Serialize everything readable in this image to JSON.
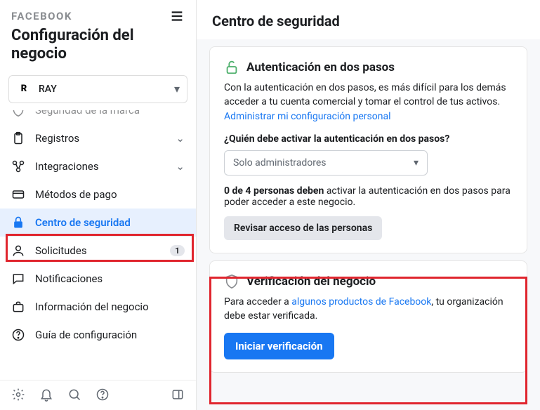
{
  "brand": "FACEBOOK",
  "title": "Configuración del negocio",
  "account": {
    "name": "RAY",
    "logo": "R"
  },
  "nav": {
    "cropped": "Seguridad de la marca",
    "registros": "Registros",
    "integraciones": "Integraciones",
    "pagos": "Métodos de pago",
    "seguridad": "Centro de seguridad",
    "solicitudes": "Solicitudes",
    "solicitudes_badge": "1",
    "notificaciones": "Notificaciones",
    "info": "Información del negocio",
    "guia": "Guía de configuración"
  },
  "main": {
    "heading": "Centro de seguridad",
    "twofa": {
      "title": "Autenticación en dos pasos",
      "desc1": "Con la autenticación en dos pasos, es más difícil para los demás acceder a tu cuenta comercial y tomar el control de tus activos. ",
      "link": "Administrar mi configuración personal",
      "question": "¿Quién debe activar la autenticación en dos pasos?",
      "select": "Solo administradores",
      "status_a": "0 de 4 personas deben",
      "status_b": " activar la autenticación en dos pasos para poder acceder a este negocio.",
      "button": "Revisar acceso de las personas"
    },
    "verify": {
      "title": "Verificación del negocio",
      "desc1": "Para acceder a ",
      "link": "algunos productos de Facebook",
      "desc2": ", tu organización debe estar verificada.",
      "button": "Iniciar verificación"
    }
  }
}
